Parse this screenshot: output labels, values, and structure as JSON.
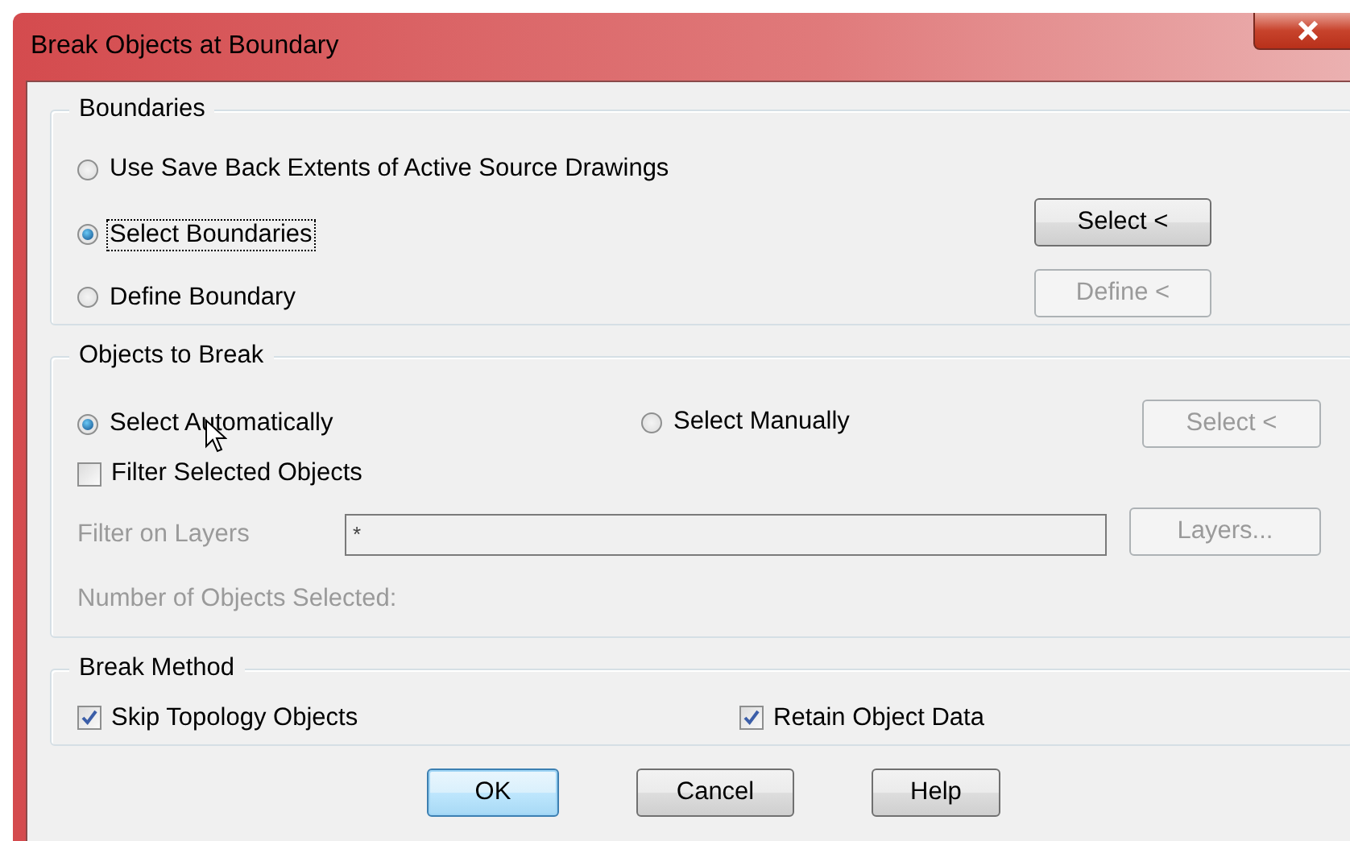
{
  "window": {
    "title": "Break Objects at Boundary"
  },
  "boundaries": {
    "title": "Boundaries",
    "options": [
      {
        "label": "Use Save Back Extents of Active Source Drawings",
        "selected": false,
        "focused": false
      },
      {
        "label": "Select Boundaries",
        "selected": true,
        "focused": true
      },
      {
        "label": "Define Boundary",
        "selected": false,
        "focused": false
      }
    ],
    "buttons": [
      {
        "label": "Select <",
        "disabled": false
      },
      {
        "label": "Define <",
        "disabled": true
      }
    ]
  },
  "objects_to_break": {
    "title": "Objects to Break",
    "options": [
      {
        "label": "Select Automatically",
        "selected": true,
        "focused": false
      },
      {
        "label": "Select Manually",
        "selected": false,
        "focused": false
      }
    ],
    "select_button": {
      "label": "Select <",
      "disabled": true
    },
    "filter_checkbox": {
      "label": "Filter Selected Objects",
      "checked": false
    },
    "filter_on_layers": {
      "label": "Filter on Layers",
      "value": "*",
      "disabled": true
    },
    "layers_button": {
      "label": "Layers...",
      "disabled": true
    },
    "count_label": {
      "text": "Number of Objects Selected:",
      "disabled": true
    }
  },
  "break_method": {
    "title": "Break Method",
    "options": [
      {
        "label": "Skip Topology Objects",
        "checked": true
      },
      {
        "label": "Retain Object Data",
        "checked": true
      }
    ]
  },
  "buttons": [
    {
      "label": "OK",
      "default": true
    },
    {
      "label": "Cancel",
      "default": false
    },
    {
      "label": "Help",
      "default": false
    }
  ]
}
